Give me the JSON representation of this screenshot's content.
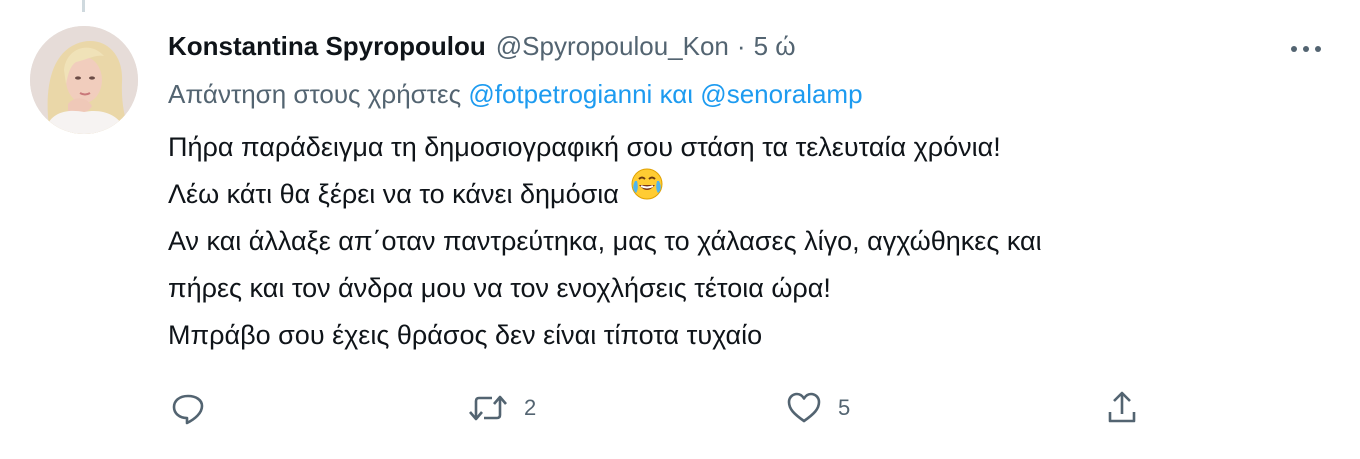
{
  "tweet": {
    "author_name": "Konstantina Spyropoulou",
    "handle": "@Spyropoulou_Kon",
    "separator": "·",
    "time": "5 ώ",
    "reply_prefix": "Απάντηση στους χρήστες",
    "mention_1": "@fotpetrogianni",
    "reply_conjunction": "και",
    "mention_2": "@senoralamp",
    "lines": [
      "Πήρα παράδειγμα τη δημοσιογραφική σου στάση τα τελευταία χρόνια!",
      "Λέω κάτι θα ξέρει να το κάνει δημόσια",
      "Αν και άλλαξε απ΄οταν παντρεύτηκα, μας το χάλασες λίγο, αγχώθηκες και",
      "πήρες και τον άνδρα μου να τον ενοχλήσεις τέτοια ώρα!",
      "Μπράβο σου έχεις θράσος δεν είναι τίποτα τυχαίο"
    ],
    "emoji": "face-with-tears-of-joy-icon"
  },
  "actions": {
    "reply_count": "",
    "retweet_count": "2",
    "like_count": "5"
  },
  "colors": {
    "text": "#0f1419",
    "secondary": "#536471",
    "link": "#1d9bf0"
  }
}
